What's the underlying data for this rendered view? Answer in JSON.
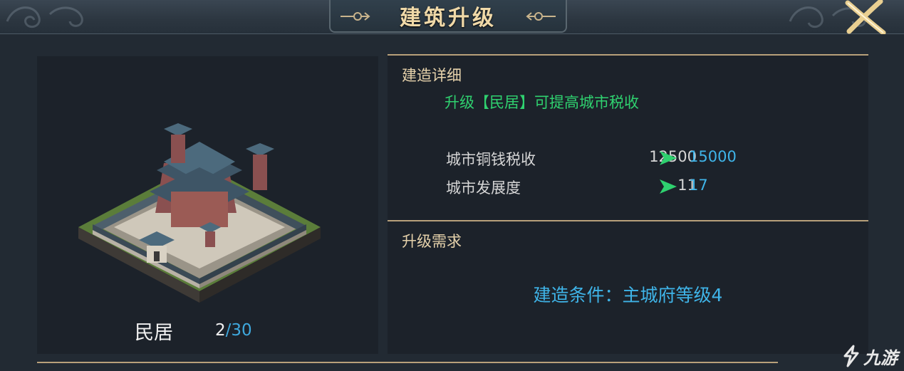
{
  "header": {
    "title": "建筑升级",
    "close_icon": "close-x-icon"
  },
  "building": {
    "name": "民居",
    "level_current": "2",
    "level_separator": "/",
    "level_max": "30"
  },
  "details": {
    "section_title": "建造详细",
    "description": "升级【民居】可提高城市税收",
    "stats": [
      {
        "label": "城市铜钱税收",
        "old": "12500",
        "new": "15000"
      },
      {
        "label": "城市发展度",
        "old": "11",
        "new": "17"
      }
    ]
  },
  "requirements": {
    "section_title": "升级需求",
    "condition": "建造条件：主城府等级4"
  },
  "watermark": {
    "text": "九游"
  },
  "colors": {
    "accent_gold": "#b8a07a",
    "green": "#2fd16f",
    "blue": "#3fb4e8"
  }
}
